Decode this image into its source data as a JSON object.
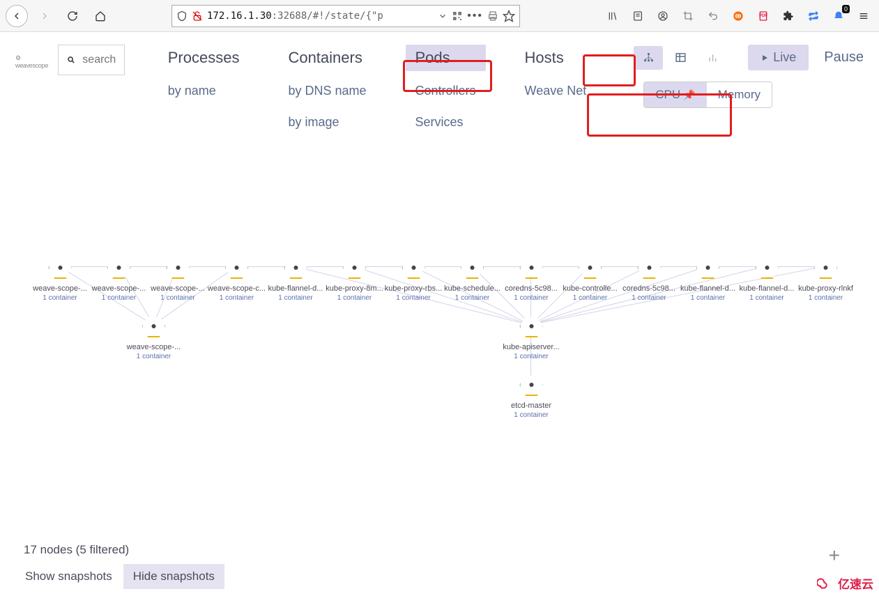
{
  "browser": {
    "url_prefix": "172.16.1.30",
    "url_suffix": ":32688/#!/state/{\"p",
    "badge": "0"
  },
  "app": {
    "logo": "weavescope",
    "search_placeholder": "search",
    "topology": {
      "col0": {
        "main": "Processes",
        "subs": [
          "by name"
        ]
      },
      "col1": {
        "main": "Containers",
        "subs": [
          "by DNS name",
          "by image"
        ]
      },
      "col2": {
        "main": "Pods",
        "subs": [
          "Controllers",
          "Services"
        ]
      },
      "col3": {
        "main": "Hosts",
        "subs": [
          "Weave Net"
        ]
      }
    },
    "metrics": {
      "cpu": "CPU",
      "memory": "Memory"
    },
    "live": "Live",
    "pause": "Pause"
  },
  "nodes": {
    "row1": [
      {
        "name": "weave-scope-...",
        "sub": "1 container",
        "col": "pink"
      },
      {
        "name": "weave-scope-...",
        "sub": "1 container",
        "col": "pink"
      },
      {
        "name": "weave-scope-...",
        "sub": "1 container",
        "col": "pink"
      },
      {
        "name": "weave-scope-c...",
        "sub": "1 container",
        "col": "pink"
      },
      {
        "name": "kube-flannel-d...",
        "sub": "1 container",
        "col": "green"
      },
      {
        "name": "kube-proxy-8m...",
        "sub": "1 container",
        "col": "green"
      },
      {
        "name": "kube-proxy-rbs...",
        "sub": "1 container",
        "col": "green"
      },
      {
        "name": "kube-schedule...",
        "sub": "1 container",
        "col": "green"
      },
      {
        "name": "coredns-5c98...",
        "sub": "1 container",
        "col": "green"
      },
      {
        "name": "kube-controlle...",
        "sub": "1 container",
        "col": "green"
      },
      {
        "name": "coredns-5c98...",
        "sub": "1 container",
        "col": "green"
      },
      {
        "name": "kube-flannel-d...",
        "sub": "1 container",
        "col": "green"
      },
      {
        "name": "kube-flannel-d...",
        "sub": "1 container",
        "col": "green"
      },
      {
        "name": "kube-proxy-rlnkf",
        "sub": "1 container",
        "col": "green"
      }
    ],
    "row2a": {
      "name": "weave-scope-...",
      "sub": "1 container",
      "col": "pink"
    },
    "row2b": {
      "name": "kube-apiserver...",
      "sub": "1 container",
      "col": "green"
    },
    "row3": {
      "name": "etcd-master",
      "sub": "1 container",
      "col": "green"
    }
  },
  "footer": {
    "status": "17 nodes (5 filtered)",
    "show": "Show snapshots",
    "hide": "Hide snapshots"
  },
  "watermark": "亿速云"
}
